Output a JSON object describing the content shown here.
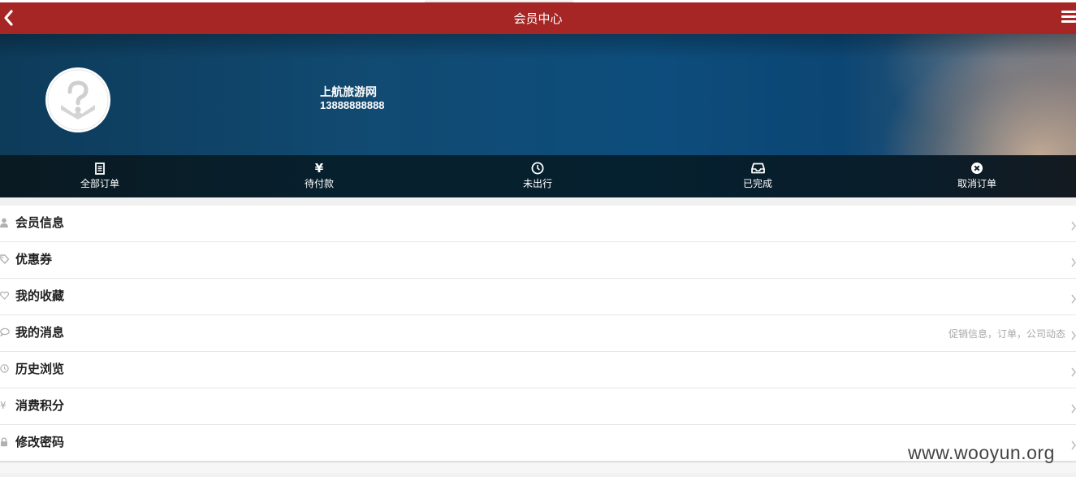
{
  "navbar": {
    "title": "会员中心",
    "back_icon": "chevron-left-icon",
    "menu_icon": "hamburger-menu-icon",
    "color": "#a52624"
  },
  "profile": {
    "name": "上航旅游网",
    "phone": "13888888888",
    "avatar_icon": "question-mark-avatar-icon"
  },
  "order_bar": [
    {
      "label": "全部订单",
      "icon": "document-icon"
    },
    {
      "label": "待付款",
      "icon": "yen-icon"
    },
    {
      "label": "未出行",
      "icon": "clock-icon"
    },
    {
      "label": "已完成",
      "icon": "inbox-icon"
    },
    {
      "label": "取消订单",
      "icon": "cancel-circle-icon"
    }
  ],
  "menu": [
    {
      "label": "会员信息",
      "icon": "user-icon",
      "hint": ""
    },
    {
      "label": "优惠券",
      "icon": "tag-icon",
      "hint": ""
    },
    {
      "label": "我的收藏",
      "icon": "heart-icon",
      "hint": ""
    },
    {
      "label": "我的消息",
      "icon": "comment-icon",
      "hint": "促销信息，订单，公司动态"
    },
    {
      "label": "历史浏览",
      "icon": "clock-icon",
      "hint": ""
    },
    {
      "label": "消费积分",
      "icon": "yen-icon",
      "hint": ""
    },
    {
      "label": "修改密码",
      "icon": "lock-icon",
      "hint": ""
    }
  ],
  "watermark": "www.wooyun.org"
}
